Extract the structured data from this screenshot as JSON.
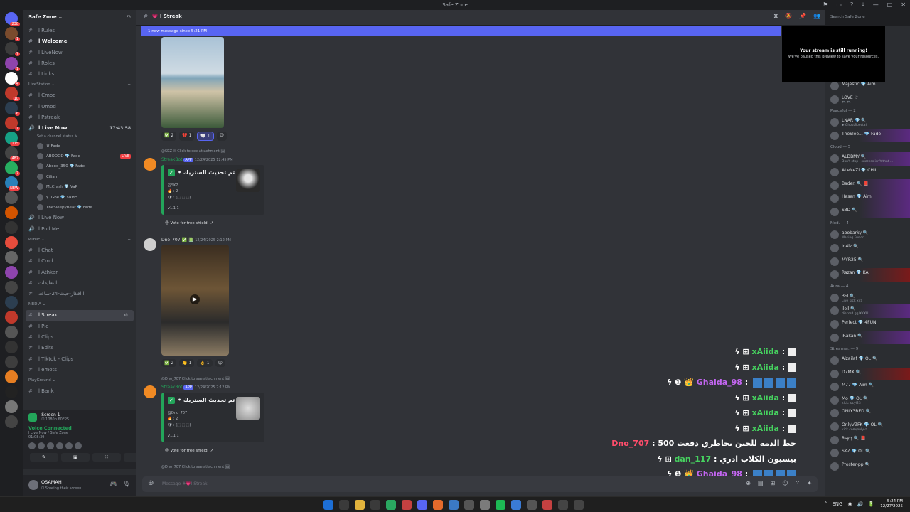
{
  "window": {
    "title": "Safe Zone",
    "controls": [
      "⚑",
      "▭",
      "?",
      "⤓",
      "—",
      "□",
      "✕"
    ]
  },
  "server": {
    "name": "Safe Zone ⌄"
  },
  "server_badges": [
    "238",
    "1",
    "7",
    "1",
    "4",
    "10",
    "6",
    "1",
    "115",
    "487",
    "7",
    "NEW"
  ],
  "channels_top": [
    {
      "icon": "#",
      "label": "ا Rules",
      "style": ""
    },
    {
      "icon": "#",
      "label": "ا Welcome",
      "style": "bold"
    },
    {
      "icon": "#",
      "label": "ا LiveNow",
      "style": ""
    },
    {
      "icon": "#",
      "label": "ا Roles",
      "style": ""
    },
    {
      "icon": "#",
      "label": "ا Links",
      "style": ""
    }
  ],
  "cat_livestation": "LiveStation ⌄",
  "channels_live": [
    {
      "icon": "#",
      "label": "ا Cmod"
    },
    {
      "icon": "#",
      "label": "ا Umod"
    },
    {
      "icon": "#",
      "label": "ا Pstreak"
    }
  ],
  "voice_live": {
    "icon": "🔊",
    "label": "ا Live Now",
    "time": "17:43:58",
    "status": "Set a channel status ✎"
  },
  "voice_users": [
    {
      "name": "♛ Fade",
      "live": ""
    },
    {
      "name": "ABOOOD 💎 Fade",
      "live": "LIVE"
    },
    {
      "name": "Abood_350 💎 Fade",
      "live": ""
    },
    {
      "name": "Cilian",
      "live": ""
    },
    {
      "name": "McCrash 💎 VaP",
      "live": ""
    },
    {
      "name": "$1Gbe 💎 $RHH",
      "live": ""
    },
    {
      "name": "TheSleepyBear 💎 Fade",
      "live": ""
    }
  ],
  "voice_other": [
    {
      "icon": "🔊",
      "label": "ا Live Now"
    },
    {
      "icon": "🔊",
      "label": "ا Pull Me"
    }
  ],
  "cat_public": "Public ⌄",
  "channels_public": [
    {
      "icon": "#",
      "label": "ا Chat"
    },
    {
      "icon": "#",
      "label": "ا Cmd"
    },
    {
      "icon": "#",
      "label": "ا Athkar"
    },
    {
      "icon": "#",
      "label": "ا تعليقات"
    },
    {
      "icon": "#",
      "label": "ا افكار-حيث-24-ساعه"
    }
  ],
  "cat_media": "MEDIA ⌄",
  "channels_media": [
    {
      "icon": "#",
      "label": "ا Streak",
      "style": "act"
    },
    {
      "icon": "#",
      "label": "ا Pic",
      "style": ""
    },
    {
      "icon": "#",
      "label": "ا Clips",
      "style": ""
    },
    {
      "icon": "#",
      "label": "ا Edits",
      "style": ""
    },
    {
      "icon": "#",
      "label": "ا Tiktok - Clips",
      "style": ""
    },
    {
      "icon": "#",
      "label": "ا emots",
      "style": ""
    }
  ],
  "cat_playground": "PlayGround ⌄",
  "channels_play": [
    {
      "icon": "#",
      "label": "ا Bank"
    }
  ],
  "screen": {
    "title": "Screen 1",
    "sub": "⊡ 1080p 60FPS"
  },
  "voice_conn": {
    "title": "Voice Connected",
    "sub": "ا Live Now / Safe Zone",
    "time": "01:08:39"
  },
  "voice_buttons": [
    "✎",
    "▣",
    "⁙",
    "◈"
  ],
  "user": {
    "name": "OSAMAH",
    "status": "⊡ Sharing their screen",
    "icons": [
      "🎮",
      "🎙",
      "🎧",
      "⚙"
    ]
  },
  "channel_header": {
    "hash": "#",
    "name": "💗 ا Streak",
    "tools": [
      "⧖",
      "🔕",
      "📌",
      "👥"
    ]
  },
  "new_message_bar": "1 new message since 5:21 PM",
  "msg1_reacts": [
    "✅ 2",
    "💔 1",
    "🤍 1",
    "☺"
  ],
  "msg2": {
    "reply": "@SKZ ✉ Click to see attachment 🖼",
    "author": "StreakBot",
    "tag": "APP",
    "time": "12/24/2025 12:45 PM",
    "title": "• تم تحديث الستريك",
    "mention": "@SKZ",
    "line1": "🔥 : 2",
    "line2": "🛡 : (⬚ ⬚ ⬚)",
    "ver": "v1.1.1",
    "vote": "😡 Vote for free shield! ↗"
  },
  "msg3": {
    "author": "Dno_707 ✅ 📗",
    "time": "12/24/2025 2:12 PM"
  },
  "msg3_reacts": [
    "✅ 2",
    "👏 1",
    "👌 1",
    "☺"
  ],
  "msg4": {
    "reply": "@Dno_707 Click to see attachment 🖼",
    "author": "StreakBot",
    "tag": "APP",
    "time": "12/24/2025 2:12 PM",
    "title": "• تم تحديث الستريك",
    "mention": "@Dno_707",
    "line1": "🔥 : 2",
    "line2": "🛡 : (⬚ ⬚ ⬚)",
    "ver": "v1.1.1",
    "vote": "😡 Vote for free shield! ↗"
  },
  "msg5_reply": "@Dno_707 Click to see attachment 🖼",
  "stream_chat": [
    {
      "pre": "ϟ ⊞ ",
      "name": "xAiida",
      "sep": " : ",
      "text": "",
      "color": "g",
      "boxes": 0,
      "white": true
    },
    {
      "pre": "ϟ ⊞ ",
      "name": "xAiida",
      "sep": " : ",
      "text": "",
      "color": "g",
      "boxes": 0,
      "white": true
    },
    {
      "pre": "ϟ ❶ 👑 ",
      "name": "Ghaida_98",
      "sep": " : ",
      "text": "",
      "color": "p",
      "boxes": 4,
      "white": false
    },
    {
      "pre": "ϟ ⊞ ",
      "name": "xAiida",
      "sep": " : ",
      "text": "",
      "color": "g",
      "boxes": 0,
      "white": true
    },
    {
      "pre": "ϟ ⊞ ",
      "name": "xAiida",
      "sep": " : ",
      "text": "",
      "color": "g",
      "boxes": 0,
      "white": true
    },
    {
      "pre": "ϟ ⊞ ",
      "name": "xAiida",
      "sep": " : ",
      "text": "",
      "color": "g",
      "boxes": 0,
      "white": true
    },
    {
      "pre": "",
      "name": "Dno_707",
      "sep": " : ",
      "text": "500 حط الدمه للحين بخاطري دفعت",
      "color": "r",
      "boxes": 0,
      "white": false
    },
    {
      "pre": "ϟ ⊞ ",
      "name": "dan_117",
      "sep": " : ",
      "text": "بيسبون الكلاب ادري",
      "color": "g",
      "boxes": 0,
      "white": false
    },
    {
      "pre": "ϟ ❶ 👑 ",
      "name": "Ghaida_98",
      "sep": " : ",
      "text": "",
      "color": "p",
      "boxes": 4,
      "white": false
    }
  ],
  "composer": {
    "placeholder": "Message #💗ا Streak",
    "icons": [
      "⊕",
      "▤",
      "⊞",
      "☺",
      "⁙",
      "✦"
    ]
  },
  "member_search": "Search Safe Zone",
  "stream_popup": {
    "title": "Your stream is still running!",
    "sub": "We've paused this preview to save your resources."
  },
  "members": [
    {
      "type": "row",
      "name": "Majestic 💎 Aim",
      "sub": "",
      "hl": ""
    },
    {
      "type": "row",
      "name": "LOVE ♡",
      "sub": "🎮 🎮",
      "hl": ""
    },
    {
      "type": "group",
      "label": "Peaceful — 2"
    },
    {
      "type": "row",
      "name": "LNAR 💎 🔍",
      "sub": "▶ GhostSpectal",
      "hl": ""
    },
    {
      "type": "row",
      "name": "TheSlee... 💎 Fade",
      "sub": "",
      "hl": "hl"
    },
    {
      "type": "group",
      "label": "Cloud — 5"
    },
    {
      "type": "row",
      "name": "ALDBMY 🔍",
      "sub": "Don't stop , success isn't that ...",
      "hl": "hl"
    },
    {
      "type": "row",
      "name": "ALeNeZi 💎 CHIL",
      "sub": "",
      "hl": ""
    },
    {
      "type": "row",
      "name": "Bader. 🔍 📕",
      "sub": "",
      "hl": "hl"
    },
    {
      "type": "row",
      "name": "Hasan 💎 Aim",
      "sub": "",
      "hl": "hl"
    },
    {
      "type": "row",
      "name": "S3D 🔍",
      "sub": "",
      "hl": "hl"
    },
    {
      "type": "group",
      "label": "Mod. — 4"
    },
    {
      "type": "row",
      "name": "abobarky 🔍",
      "sub": "Making Fusion",
      "hl": ""
    },
    {
      "type": "row",
      "name": "iq4lz 🔍",
      "sub": "",
      "hl": ""
    },
    {
      "type": "row",
      "name": "MYR25 🔍",
      "sub": "",
      "hl": ""
    },
    {
      "type": "row",
      "name": "Razan 💎 KA",
      "sub": "",
      "hl": "hr"
    },
    {
      "type": "group",
      "label": "Aura — 4"
    },
    {
      "type": "row",
      "name": "ЗЫ 🔍",
      "sub": "Live kick xifa",
      "hl": ""
    },
    {
      "type": "row",
      "name": "ilell 🔍",
      "sub": "discord.gg/XKXU",
      "hl": "hl"
    },
    {
      "type": "row",
      "name": "Perfect 💎 4FUN",
      "sub": "",
      "hl": ""
    },
    {
      "type": "row",
      "name": "iRakan 🔍",
      "sub": "",
      "hl": "hl"
    },
    {
      "type": "group",
      "label": "Streamer. — 9"
    },
    {
      "type": "row",
      "name": "Alzailaf 💎 OL 🔍",
      "sub": "",
      "hl": ""
    },
    {
      "type": "row",
      "name": "D7MX 🔍",
      "sub": "",
      "hl": "hr"
    },
    {
      "type": "row",
      "name": "M77 💎 Aim 🔍",
      "sub": "",
      "hl": ""
    },
    {
      "type": "row",
      "name": "Mo 💎 OL 🔍",
      "sub": "kick: ocyl23",
      "hl": ""
    },
    {
      "type": "row",
      "name": "ONLY3BED 🔍",
      "sub": "",
      "hl": ""
    },
    {
      "type": "row",
      "name": "OnlyVZFK 💎 OL 🔍",
      "sub": "kick.com/onlyvz",
      "hl": ""
    },
    {
      "type": "row",
      "name": "Rsyq 🔍 📕",
      "sub": "",
      "hl": ""
    },
    {
      "type": "row",
      "name": "SKZ 💎 OL 🔍",
      "sub": "",
      "hl": ""
    },
    {
      "type": "row",
      "name": "Proster-pp 🔍",
      "sub": "",
      "hl": ""
    }
  ],
  "taskbar": {
    "icons": [
      "#1d6fd6",
      "#3a3a3a",
      "#e2b33c",
      "#3a3a3a",
      "#2aa860",
      "#c54141",
      "#5865f2",
      "#e56a2b",
      "#3b79c4",
      "#555555",
      "#7b7b7b",
      "#1db954",
      "#3a7bd5",
      "#555555",
      "#c54141",
      "#444444",
      "#444444"
    ],
    "tray_icons": [
      "˄",
      "ENG",
      "◉",
      "🔊",
      "🔋"
    ],
    "time": "5:24 PM",
    "date": "12/27/2025"
  }
}
